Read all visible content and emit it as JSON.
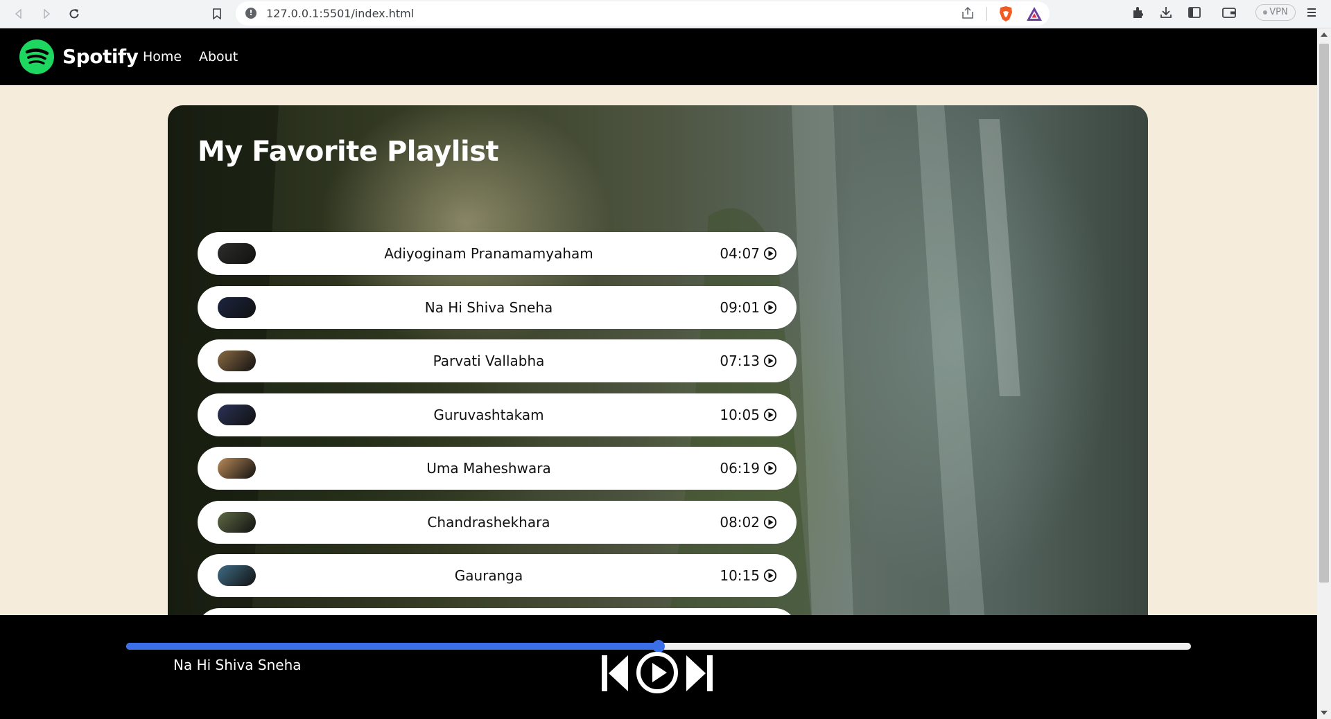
{
  "browser": {
    "url": "127.0.0.1:5501/index.html",
    "vpn_label": "VPN"
  },
  "nav": {
    "brand": "Spotify",
    "links": [
      "Home",
      "About"
    ]
  },
  "playlist": {
    "title": "My Favorite Playlist",
    "songs": [
      {
        "name": "Adiyoginam Pranamamyaham",
        "duration": "04:07",
        "thumb_color": "#2c2e2a"
      },
      {
        "name": "Na Hi Shiva Sneha",
        "duration": "09:01",
        "thumb_color": "#1c2540"
      },
      {
        "name": "Parvati Vallabha",
        "duration": "07:13 ",
        "thumb_color": "#8a6a44"
      },
      {
        "name": "Guruvashtakam",
        "duration": "10:05",
        "thumb_color": "#2a3256"
      },
      {
        "name": "Uma Maheshwara",
        "duration": "06:19",
        "thumb_color": "#b98a58"
      },
      {
        "name": "Chandrashekhara",
        "duration": "08:02",
        "thumb_color": "#5e6a44"
      },
      {
        "name": "Gauranga",
        "duration": "10:15",
        "thumb_color": "#3f6c84"
      }
    ]
  },
  "player": {
    "now_playing": "Na Hi Shiva Sneha",
    "progress": 0.5,
    "accent": "#3b6fe8"
  },
  "icons": {
    "playlist_item": "play-circle-icon",
    "controls": [
      "previous-icon",
      "play-circle-icon",
      "next-icon"
    ]
  }
}
